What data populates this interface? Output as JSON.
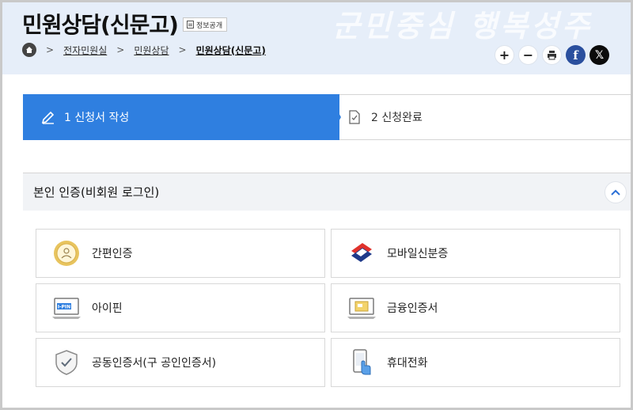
{
  "header": {
    "title": "민원상담(신문고)",
    "info_badge": "정보공개",
    "watermark": "군민중심 행복성주"
  },
  "breadcrumb": {
    "items": [
      "전자민원실",
      "민원상담",
      "민원상담(신문고)"
    ]
  },
  "toolbar": {
    "zoom_in": "+",
    "zoom_out": "−",
    "facebook": "f",
    "x": "𝕏"
  },
  "stepper": {
    "steps": [
      {
        "label": "1 신청서 작성",
        "state": "active"
      },
      {
        "label": "2 신청완료",
        "state": "inactive"
      }
    ]
  },
  "section": {
    "title": "본인 인증(비회원 로그인)"
  },
  "auth_methods": [
    {
      "label": "간편인증",
      "icon": "simple-auth-icon"
    },
    {
      "label": "모바일신분증",
      "icon": "mobile-id-icon"
    },
    {
      "label": "아이핀",
      "icon": "ipin-icon"
    },
    {
      "label": "금융인증서",
      "icon": "financial-cert-icon"
    },
    {
      "label": "공동인증서(구 공인인증서)",
      "icon": "joint-cert-icon"
    },
    {
      "label": "휴대전화",
      "icon": "mobile-phone-icon"
    }
  ],
  "colors": {
    "header_bg": "#e6eef9",
    "step_active": "#2f7fe0",
    "accent": "#2a6fd6"
  }
}
